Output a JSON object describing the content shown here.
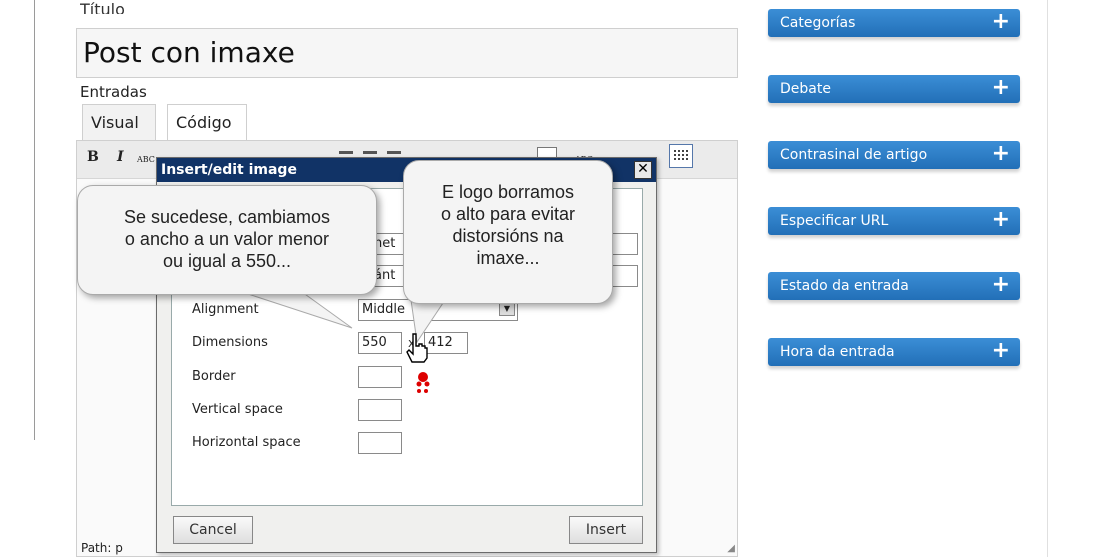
{
  "editor": {
    "title_label": "Título",
    "title_value": "Post con imaxe",
    "entries_label": "Entradas",
    "tabs": [
      {
        "label": "Visual",
        "active": true
      },
      {
        "label": "Código",
        "active": false
      }
    ],
    "toolbar": {
      "bold": "B",
      "italic": "I",
      "spell": "ABC"
    },
    "path_text": "Path: p"
  },
  "dialog": {
    "title": "Insert/edit image",
    "close_label": "✕",
    "fields": {
      "row1_partial": "net",
      "row2_partial": "ánt",
      "alignment_label": "Alignment",
      "alignment_value": "Middle",
      "dimensions_label": "Dimensions",
      "width_value": "550",
      "times_symbol": "x",
      "height_value": "412",
      "border_label": "Border",
      "vspace_label": "Vertical space",
      "hspace_label": "Horizontal space"
    },
    "cancel_label": "Cancel",
    "insert_label": "Insert"
  },
  "callouts": {
    "left": [
      "Se sucedese, cambiamos",
      "o ancho a un valor menor",
      "ou igual a 550..."
    ],
    "right": [
      "E logo borramos",
      "o alto para evitar",
      "distorsións na",
      "imaxe..."
    ]
  },
  "sidebar": {
    "items": [
      {
        "label": "Categorías",
        "icon": "plus-icon"
      },
      {
        "label": "Debate",
        "icon": "plus-icon"
      },
      {
        "label": "Contrasinal de artigo",
        "icon": "plus-icon"
      },
      {
        "label": "Especificar URL",
        "icon": "plus-icon"
      },
      {
        "label": "Estado da entrada",
        "icon": "plus-icon"
      },
      {
        "label": "Hora da entrada",
        "icon": "plus-icon"
      }
    ],
    "plus_glyph": "+"
  },
  "colors": {
    "sidebar_blue": "#2a7cc7",
    "dialog_title_bg": "#113366",
    "annotation_red": "#dd0000"
  }
}
